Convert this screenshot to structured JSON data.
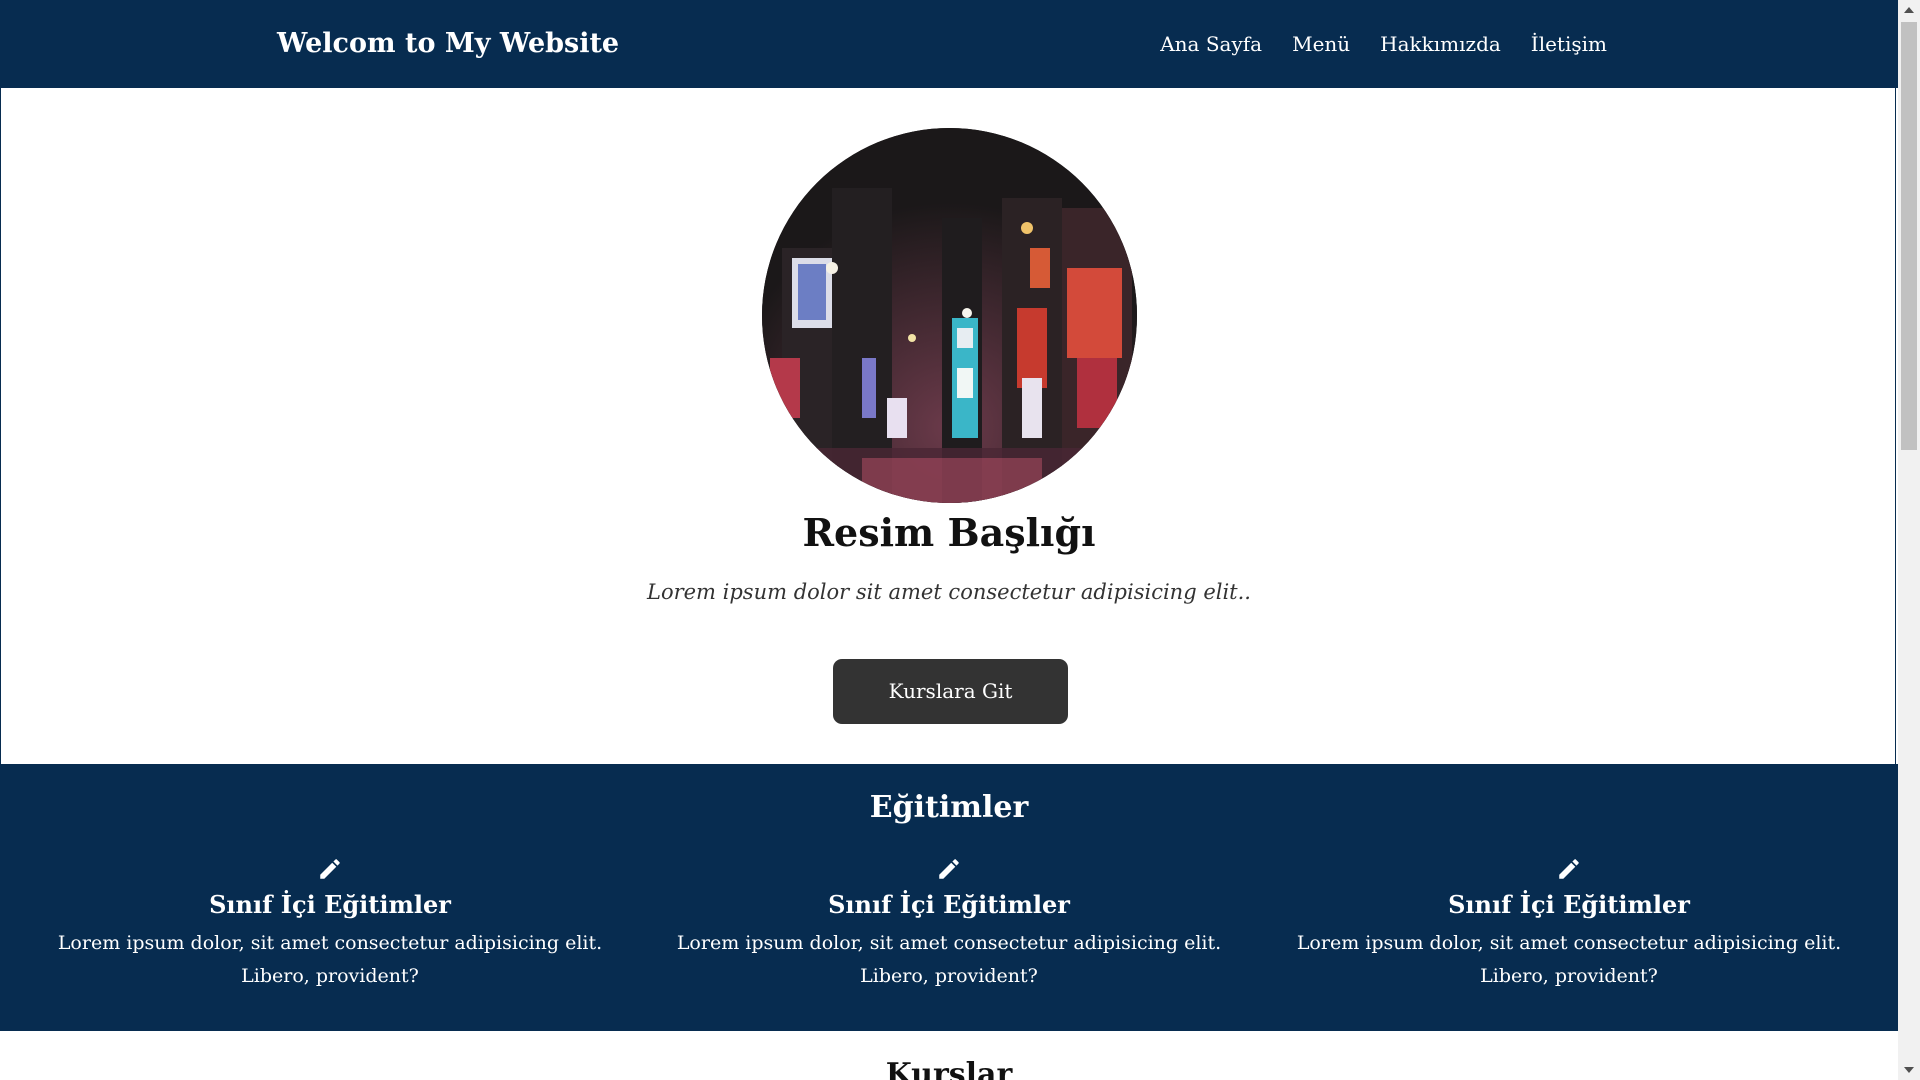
{
  "navbar": {
    "brand": "Welcom to My Website",
    "links": [
      "Ana Sayfa",
      "Menü",
      "Hakkımızda",
      "İletişim"
    ]
  },
  "hero": {
    "title": "Resim Başlığı",
    "subtitle": "Lorem ipsum dolor sit amet consectetur adipisicing elit..",
    "button_label": "Kurslara Git"
  },
  "trainings": {
    "title": "Eğitimler",
    "items": [
      {
        "icon": "pencil-icon",
        "title": "Sınıf İçi Eğitimler",
        "text": "Lorem ipsum dolor, sit amet consectetur adipisicing elit. Libero, provident?"
      },
      {
        "icon": "pencil-icon",
        "title": "Sınıf İçi Eğitimler",
        "text": "Lorem ipsum dolor, sit amet consectetur adipisicing elit. Libero, provident?"
      },
      {
        "icon": "pencil-icon",
        "title": "Sınıf İçi Eğitimler",
        "text": "Lorem ipsum dolor, sit amet consectetur adipisicing elit. Libero, provident?"
      }
    ]
  },
  "courses": {
    "title": "Kurslar"
  },
  "colors": {
    "primary": "#072c50",
    "button": "#333333"
  }
}
